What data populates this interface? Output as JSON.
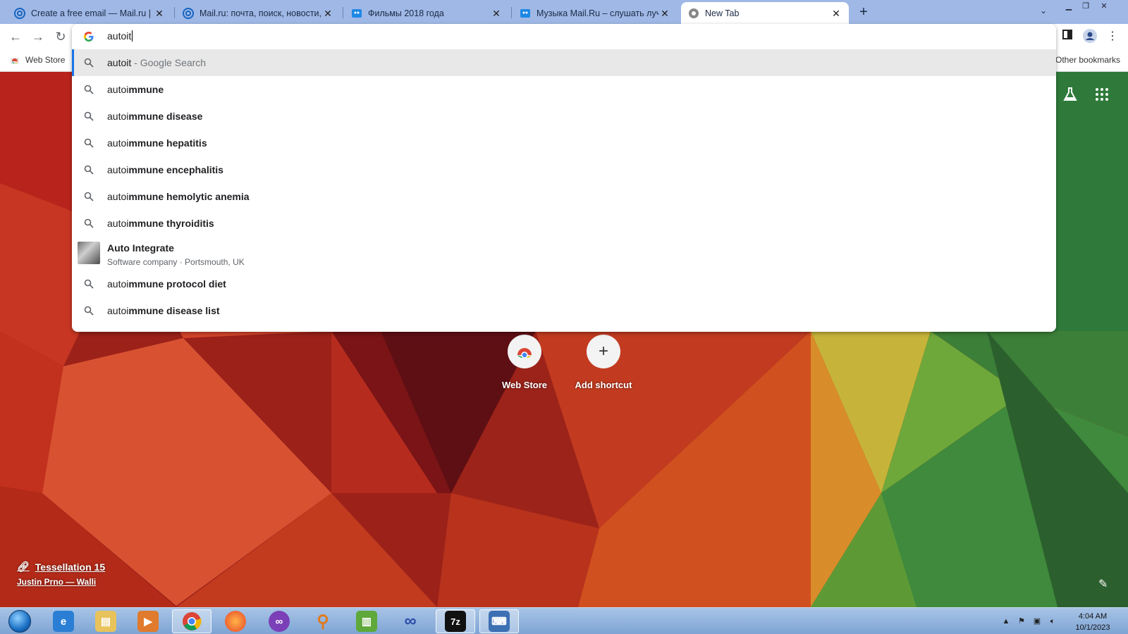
{
  "tabs": [
    {
      "title": "Create a free email — Mail.ru | Re",
      "icon": "mailru-icon",
      "active": false
    },
    {
      "title": "Mail.ru: почта, поиск, новости, м",
      "icon": "mailru-icon",
      "active": false
    },
    {
      "title": "Фильмы 2018 года",
      "icon": "mail-movies-icon",
      "active": false
    },
    {
      "title": "Музыка Mail.Ru – слушать лучш",
      "icon": "mail-music-icon",
      "active": false
    },
    {
      "title": "New Tab",
      "icon": "chrome-icon",
      "active": true
    }
  ],
  "omnibox": {
    "input_value": "autoit",
    "suggestions": [
      {
        "prefix": "autoit",
        "bold": "",
        "suffix": " - Google Search",
        "selected": true
      },
      {
        "prefix": "autoi",
        "bold": "mmune",
        "suffix": "",
        "selected": false
      },
      {
        "prefix": "autoi",
        "bold": "mmune disease",
        "suffix": "",
        "selected": false
      },
      {
        "prefix": "autoi",
        "bold": "mmune hepatitis",
        "suffix": "",
        "selected": false
      },
      {
        "prefix": "autoi",
        "bold": "mmune encephalitis",
        "suffix": "",
        "selected": false
      },
      {
        "prefix": "autoi",
        "bold": "mmune hemolytic anemia",
        "suffix": "",
        "selected": false
      },
      {
        "prefix": "autoi",
        "bold": "mmune thyroiditis",
        "suffix": "",
        "selected": false
      },
      {
        "prefix": "autoi",
        "bold": "mmune protocol diet",
        "suffix": "",
        "selected": false
      },
      {
        "prefix": "autoi",
        "bold": "mmune disease list",
        "suffix": "",
        "selected": false
      }
    ],
    "entity": {
      "title": "Auto Integrate",
      "subtitle": "Software company · Portsmouth, UK"
    }
  },
  "bookmarks": {
    "web_store": "Web Store",
    "other": "Other bookmarks"
  },
  "shortcuts": [
    {
      "label": "Web Store",
      "icon": "chrome-webstore-icon"
    },
    {
      "label": "Add shortcut",
      "icon": "plus-icon"
    }
  ],
  "attribution": {
    "title": "Tessellation 15",
    "author": "Justin Prno — Walli"
  },
  "taskbar": {
    "items": [
      "internet-explorer-icon",
      "file-explorer-icon",
      "media-player-icon",
      "chrome-icon",
      "firefox-icon",
      "incognito-mask-icon",
      "magnifier-icon",
      "notepad-chart-icon",
      "infinity-icon",
      "7zip-icon",
      "keyboard-icon"
    ],
    "time": "4:04 AM",
    "date": "10/1/2023"
  },
  "colors": {
    "tabstrip": "#9fb8e6",
    "selection_accent": "#1a73e8",
    "taskbar": "#8fb0dc"
  }
}
